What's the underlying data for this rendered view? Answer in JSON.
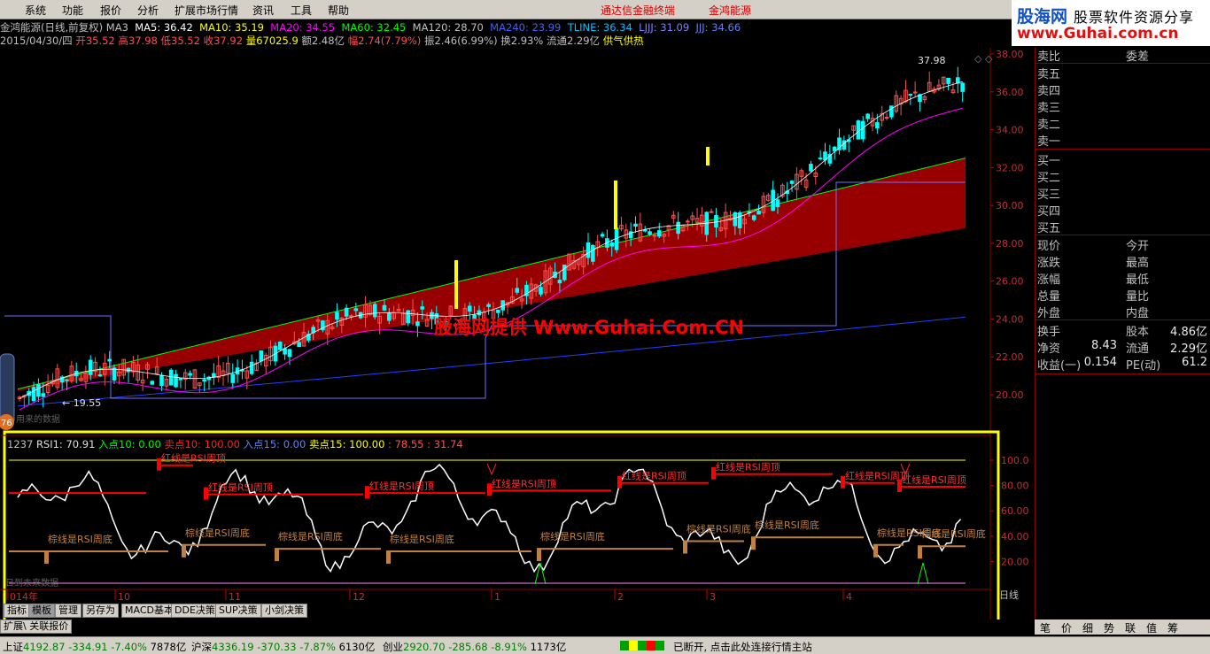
{
  "menu": {
    "items": [
      "系统",
      "功能",
      "报价",
      "分析",
      "扩展市场行情",
      "资讯",
      "工具",
      "帮助"
    ],
    "links": [
      "通达信金融终端",
      "金鸿能源"
    ]
  },
  "logo": {
    "line1": "股海网",
    "line1b": "股票软件资源分享",
    "line2": "www.Guhai.com.cn"
  },
  "title": {
    "name": "金鸿能源(日线,前复权)",
    "ma3": "MA3",
    "ma5": "MA5: 36.42",
    "ma10": "MA10: 35.19",
    "ma20": "MA20: 34.55",
    "ma60": "MA60: 32.45",
    "ma120": "MA120: 28.70",
    "ma240": "MA240: 23.99",
    "tline": "TLINE: 36.34",
    "ljjj": "LJJJ: 31.09",
    "jjj": "JJJ: 34.66"
  },
  "info": {
    "date": "2015/04/30/四",
    "open_l": "开",
    "open": "35.52",
    "high_l": "高",
    "high": "37.98",
    "low_l": "低",
    "low": "35.52",
    "close_l": "收",
    "close": "37.92",
    "vol_l": "量",
    "vol": "67025.9",
    "amt": "额2.48亿",
    "amp_l": "幅",
    "amp": "2.74(7.79%)",
    "swing": "振2.46(6.99%)",
    "turn": "换2.93%",
    "float": "流通2.29亿",
    "tag": "供气供热"
  },
  "chart": {
    "price_axis": [
      "38.00",
      "36.00",
      "34.00",
      "32.00",
      "30.00",
      "28.00",
      "26.00",
      "24.00",
      "22.00",
      "20.00"
    ],
    "hi_label": "37.98",
    "lo_label": "19.55",
    "watermark": "股海网提供 Www.Guhai.Com.CN",
    "mini_badge": "76",
    "mini_text": "用来的数据"
  },
  "sub": {
    "h0": "1237",
    "h1": "RSI1: 70.91",
    "h2": "入点10: 0.00",
    "h3": "卖点10: 100.00",
    "h4": "入点15: 0.00",
    "h5": "卖点15: 100.00",
    "h6": "78.55",
    "h7": "31.74",
    "axis": [
      "100.0",
      "80.00",
      "60.00",
      "40.00",
      "20.00"
    ],
    "top_label": "红线是RSI周顶",
    "bot_label": "棕线是RSI周底",
    "footer": "日到未来数据",
    "months": [
      "014年",
      "10",
      "11",
      "12",
      "1",
      "2",
      "3",
      "4"
    ],
    "period": "日线"
  },
  "tabs": [
    "指标",
    "模板",
    "管理",
    "另存为",
    "MACD基本",
    "DDE决策",
    "SUP决策",
    "小剑决策"
  ],
  "tabs2": [
    "扩展\\",
    "关联报价"
  ],
  "right": {
    "header": [
      "卖比",
      "委差"
    ],
    "asks": [
      "卖五",
      "卖四",
      "卖三",
      "卖二",
      "卖一"
    ],
    "bids": [
      "买一",
      "买二",
      "买三",
      "买四",
      "买五"
    ],
    "quote": [
      [
        "现价",
        "今开"
      ],
      [
        "涨跌",
        "最高"
      ],
      [
        "涨幅",
        "最低"
      ],
      [
        "总量",
        "量比"
      ],
      [
        "外盘",
        "内盘"
      ]
    ],
    "fund": [
      [
        "换手",
        "股本",
        "4.86亿"
      ],
      [
        "净资",
        "8.43",
        "流通",
        "2.29亿"
      ],
      [
        "收益(一)",
        "0.154",
        "PE(动)",
        "61.2"
      ]
    ],
    "btabs": [
      "笔",
      "价",
      "细",
      "势",
      "联",
      "值",
      "筹"
    ]
  },
  "status": {
    "sh_l": "上证",
    "sh": "4192.87",
    "sh_c": "-334.91",
    "sh_p": "-7.40%",
    "sh_a": "7878亿",
    "sz_l": "沪深",
    "sz": "4336.19",
    "sz_c": "-370.33",
    "sz_p": "-7.87%",
    "sz_a": "6130亿",
    "cy_l": "创业",
    "cy": "2920.70",
    "cy_c": "-285.68",
    "cy_p": "-8.91%",
    "cy_a": "1173亿",
    "msg": "已断开, 点击此处连接行情主站"
  },
  "colors": {
    "up": "#ff5050",
    "down": "#00ffff",
    "ma20": "#ff00ff",
    "ma60": "#00ff00",
    "ma120": "#ffff00",
    "band": "#a00000",
    "rsi": "#ffffff",
    "top": "#ff0000",
    "bot": "#c08040"
  }
}
